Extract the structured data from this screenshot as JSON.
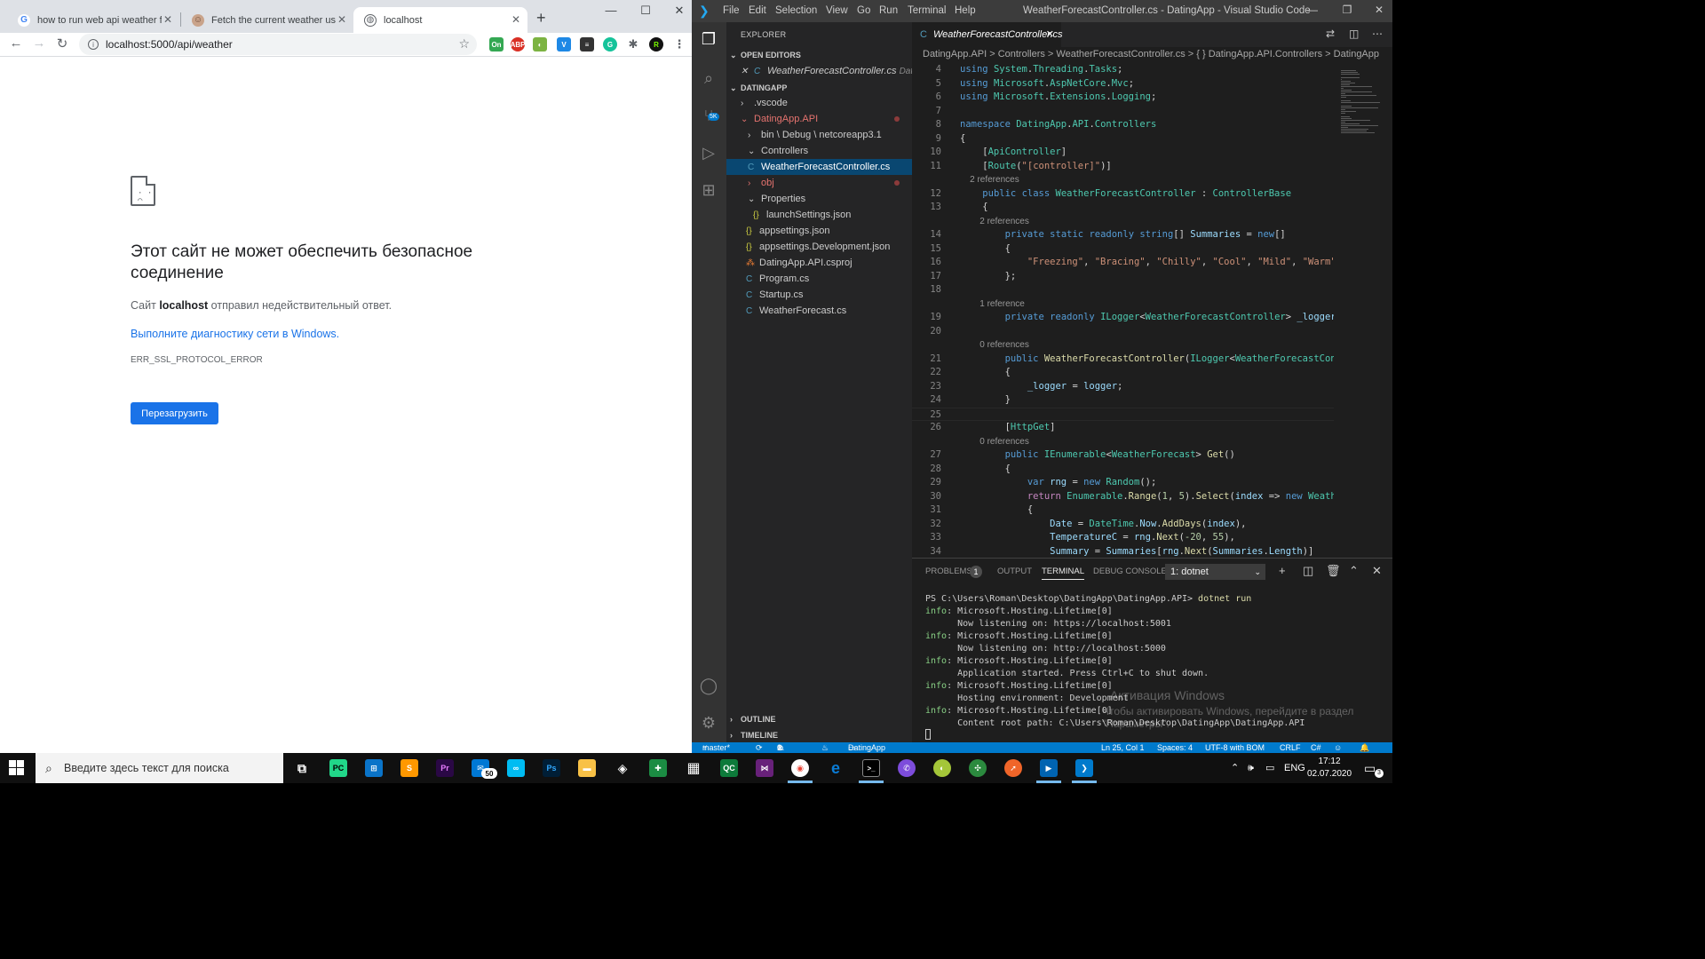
{
  "chrome": {
    "tabs": [
      {
        "title": "how to run web api weather fore",
        "favicon": "google-icon"
      },
      {
        "title": "Fetch the current weather using",
        "favicon": "avatar-icon"
      },
      {
        "title": "localhost",
        "favicon": "globe-icon"
      }
    ],
    "url": "localhost:5000/api/weather",
    "error": {
      "title": "Этот сайт не может обеспечить безопасное соединение",
      "desc_prefix": "Сайт",
      "desc_host": "localhost",
      "desc_suffix": "отправил недействительный ответ.",
      "link": "Выполните диагностику сети в Windows.",
      "code": "ERR_SSL_PROTOCOL_ERROR",
      "reload": "Перезагрузить"
    }
  },
  "vscode": {
    "menu": [
      "File",
      "Edit",
      "Selection",
      "View",
      "Go",
      "Run",
      "Terminal",
      "Help"
    ],
    "window_title": "WeatherForecastController.cs - DatingApp - Visual Studio Code",
    "explorer": {
      "header": "EXPLORER",
      "open_editors": "OPEN EDITORS",
      "open_file": "WeatherForecastController.cs",
      "open_file_path": "Dat...",
      "workspace": "DATINGAPP",
      "tree": [
        {
          "label": ".vscode",
          "icon": "chevron-right"
        },
        {
          "label": "DatingApp.API",
          "icon": "chevron-down"
        },
        {
          "label": "bin \\ Debug \\ netcoreapp3.1",
          "icon": "chevron-right"
        },
        {
          "label": "Controllers",
          "icon": "chevron-down"
        },
        {
          "label": "WeatherForecastController.cs",
          "icon": "csharp"
        },
        {
          "label": "obj",
          "icon": "chevron-right"
        },
        {
          "label": "Properties",
          "icon": "chevron-down"
        },
        {
          "label": "launchSettings.json",
          "icon": "json"
        },
        {
          "label": "appsettings.json",
          "icon": "json"
        },
        {
          "label": "appsettings.Development.json",
          "icon": "json"
        },
        {
          "label": "DatingApp.API.csproj",
          "icon": "rss"
        },
        {
          "label": "Program.cs",
          "icon": "csharp"
        },
        {
          "label": "Startup.cs",
          "icon": "csharp"
        },
        {
          "label": "WeatherForecast.cs",
          "icon": "csharp"
        }
      ],
      "outline": "OUTLINE",
      "timeline": "TIMELINE"
    },
    "editor": {
      "tab": "WeatherForecastController.cs",
      "breadcrumbs": "DatingApp.API  >  Controllers  >  WeatherForecastController.cs  >  { } DatingApp.API.Controllers  >  DatingApp",
      "lines": [
        {
          "n": "4",
          "html": "<span class='k'>using</span> <span class='t'>System</span>.<span class='t'>Threading</span>.<span class='t'>Tasks</span>;"
        },
        {
          "n": "5",
          "html": "<span class='k'>using</span> <span class='t'>Microsoft</span>.<span class='t'>AspNetCore</span>.<span class='t'>Mvc</span>;"
        },
        {
          "n": "6",
          "html": "<span class='k'>using</span> <span class='t'>Microsoft</span>.<span class='t'>Extensions</span>.<span class='t'>Logging</span>;"
        },
        {
          "n": "7",
          "html": ""
        },
        {
          "n": "8",
          "html": "<span class='k'>namespace</span> <span class='t'>DatingApp</span>.<span class='t'>API</span>.<span class='t'>Controllers</span>"
        },
        {
          "n": "9",
          "html": "{"
        },
        {
          "n": "10",
          "html": "    [<span class='t'>ApiController</span>]"
        },
        {
          "n": "11",
          "html": "    [<span class='t'>Route</span>(<span class='s'>\"[controller]\"</span>)]"
        },
        {
          "n": "",
          "hint": "    2 references"
        },
        {
          "n": "12",
          "html": "    <span class='k'>public</span> <span class='k'>class</span> <span class='t'>WeatherForecastController</span> : <span class='t'>ControllerBase</span>"
        },
        {
          "n": "13",
          "html": "    {"
        },
        {
          "n": "",
          "hint": "        2 references"
        },
        {
          "n": "14",
          "html": "        <span class='k'>private</span> <span class='k'>static</span> <span class='k'>readonly</span> <span class='k'>string</span>[] <span class='v'>Summaries</span> = <span class='k'>new</span>[]"
        },
        {
          "n": "15",
          "html": "        {"
        },
        {
          "n": "16",
          "html": "            <span class='s'>\"Freezing\"</span>, <span class='s'>\"Bracing\"</span>, <span class='s'>\"Chilly\"</span>, <span class='s'>\"Cool\"</span>, <span class='s'>\"Mild\"</span>, <span class='s'>\"Warm\"</span>"
        },
        {
          "n": "17",
          "html": "        };"
        },
        {
          "n": "18",
          "html": ""
        },
        {
          "n": "",
          "hint": "        1 reference"
        },
        {
          "n": "19",
          "html": "        <span class='k'>private</span> <span class='k'>readonly</span> <span class='t'>ILogger</span>&lt;<span class='t'>WeatherForecastController</span>&gt; <span class='v'>_logger</span>"
        },
        {
          "n": "20",
          "html": ""
        },
        {
          "n": "",
          "hint": "        0 references"
        },
        {
          "n": "21",
          "html": "        <span class='k'>public</span> <span class='f'>WeatherForecastController</span>(<span class='t'>ILogger</span>&lt;<span class='t'>WeatherForecastCon</span>"
        },
        {
          "n": "22",
          "html": "        {"
        },
        {
          "n": "23",
          "html": "            <span class='v'>_logger</span> = <span class='v'>logger</span>;"
        },
        {
          "n": "24",
          "html": "        }"
        },
        {
          "n": "25",
          "html": ""
        },
        {
          "n": "26",
          "html": "        [<span class='t'>HttpGet</span>]"
        },
        {
          "n": "",
          "hint": "        0 references"
        },
        {
          "n": "27",
          "html": "        <span class='k'>public</span> <span class='t'>IEnumerable</span>&lt;<span class='t'>WeatherForecast</span>&gt; <span class='f'>Get</span>()"
        },
        {
          "n": "28",
          "html": "        {"
        },
        {
          "n": "29",
          "html": "            <span class='k'>var</span> <span class='v'>rng</span> = <span class='k'>new</span> <span class='t'>Random</span>();"
        },
        {
          "n": "30",
          "html": "            <span class='c2'>return</span> <span class='t'>Enumerable</span>.<span class='f'>Range</span>(<span class='n'>1</span>, <span class='n'>5</span>).<span class='f'>Select</span>(<span class='v'>index</span> =&gt; <span class='k'>new</span> <span class='t'>Weath</span>"
        },
        {
          "n": "31",
          "html": "            {"
        },
        {
          "n": "32",
          "html": "                <span class='v'>Date</span> = <span class='t'>DateTime</span>.<span class='v'>Now</span>.<span class='f'>AddDays</span>(<span class='v'>index</span>),"
        },
        {
          "n": "33",
          "html": "                <span class='v'>TemperatureC</span> = <span class='v'>rng</span>.<span class='f'>Next</span>(<span class='n'>-20</span>, <span class='n'>55</span>),"
        },
        {
          "n": "34",
          "html": "                <span class='v'>Summary</span> = <span class='v'>Summaries</span>[<span class='v'>rng</span>.<span class='f'>Next</span>(<span class='v'>Summaries</span>.<span class='v'>Length</span>)]"
        }
      ]
    },
    "panel": {
      "tabs": [
        "PROBLEMS",
        "OUTPUT",
        "TERMINAL",
        "DEBUG CONSOLE"
      ],
      "problems_count": "1",
      "terminal_select": "1: dotnet",
      "terminal": [
        {
          "cls": "",
          "text": "PS C:\\Users\\Roman\\Desktop\\DatingApp\\DatingApp.API> ",
          "cmd": "dotnet run"
        },
        {
          "cls": "info",
          "text": "info",
          "rest": ": Microsoft.Hosting.Lifetime[0]"
        },
        {
          "cls": "",
          "text": "      Now listening on: https://localhost:5001"
        },
        {
          "cls": "info",
          "text": "info",
          "rest": ": Microsoft.Hosting.Lifetime[0]"
        },
        {
          "cls": "",
          "text": "      Now listening on: http://localhost:5000"
        },
        {
          "cls": "info",
          "text": "info",
          "rest": ": Microsoft.Hosting.Lifetime[0]"
        },
        {
          "cls": "",
          "text": "      Application started. Press Ctrl+C to shut down."
        },
        {
          "cls": "info",
          "text": "info",
          "rest": ": Microsoft.Hosting.Lifetime[0]"
        },
        {
          "cls": "",
          "text": "      Hosting environment: Development"
        },
        {
          "cls": "info",
          "text": "info",
          "rest": ": Microsoft.Hosting.Lifetime[0]"
        },
        {
          "cls": "",
          "text": "      Content root path: C:\\Users\\Roman\\Desktop\\DatingApp\\DatingApp.API"
        }
      ],
      "watermark_title": "Активация Windows",
      "watermark_text": "Чтобы активировать Windows, перейдите в раздел \"Параметры\"."
    },
    "status": {
      "branch": "master*",
      "errors": "1",
      "warnings": "0",
      "project": "DatingApp",
      "position": "Ln 25, Col 1",
      "spaces": "Spaces: 4",
      "encoding": "UTF-8 with BOM",
      "eol": "CRLF",
      "lang": "C#"
    }
  },
  "taskbar": {
    "search_placeholder": "Введите здесь текст для поиска",
    "lang": "ENG",
    "time": "17:12",
    "date": "02.07.2020",
    "notifications": "3",
    "mail_badge": "50"
  }
}
